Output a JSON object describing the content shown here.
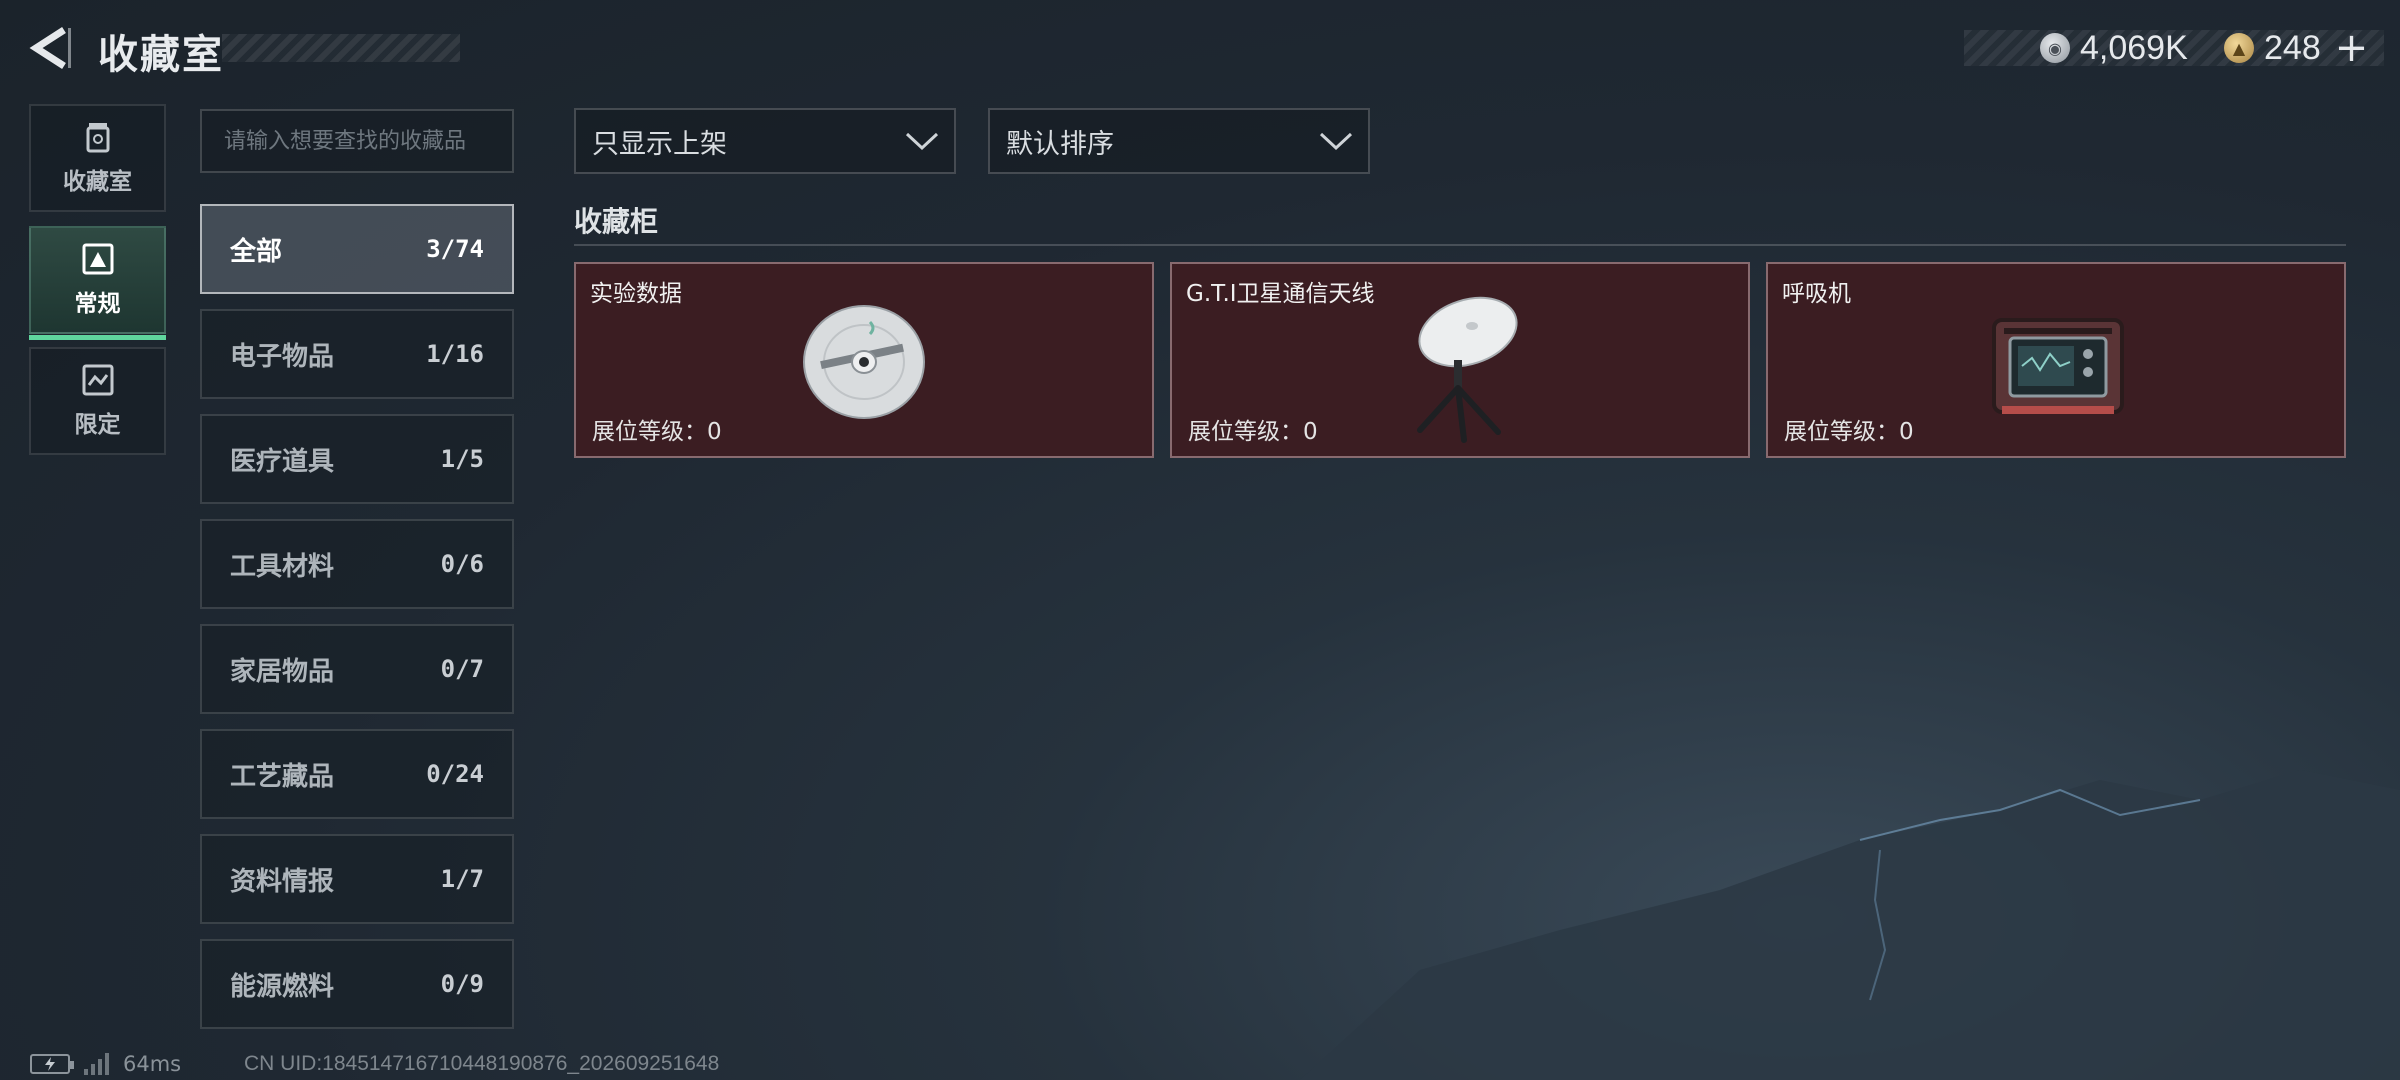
{
  "header": {
    "title": "收藏室",
    "currency": [
      {
        "icon": "silver-coin-icon",
        "value": "4,069K"
      },
      {
        "icon": "gold-coin-icon",
        "value": "248"
      }
    ],
    "add_label": "+"
  },
  "rail": {
    "items": [
      {
        "label": "收藏室",
        "icon": "collection-room-icon",
        "active": false
      },
      {
        "label": "常规",
        "icon": "regular-icon",
        "active": true
      },
      {
        "label": "限定",
        "icon": "limited-icon",
        "active": false
      }
    ]
  },
  "search": {
    "placeholder": "请输入想要查找的收藏品"
  },
  "categories": [
    {
      "name": "全部",
      "count": "3/74",
      "active": true
    },
    {
      "name": "电子物品",
      "count": "1/16"
    },
    {
      "name": "医疗道具",
      "count": "1/5"
    },
    {
      "name": "工具材料",
      "count": "0/6"
    },
    {
      "name": "家居物品",
      "count": "0/7"
    },
    {
      "name": "工艺藏品",
      "count": "0/24"
    },
    {
      "name": "资料情报",
      "count": "1/7"
    },
    {
      "name": "能源燃料",
      "count": "0/9"
    }
  ],
  "filters": {
    "shelf": "只显示上架",
    "sort": "默认排序"
  },
  "cabinet": {
    "title": "收藏柜",
    "items": [
      {
        "name": "实验数据",
        "level": "展位等级：0",
        "icon": "data-disc-icon"
      },
      {
        "name": "G.T.I卫星通信天线",
        "level": "展位等级：0",
        "icon": "satellite-antenna-icon"
      },
      {
        "name": "呼吸机",
        "level": "展位等级：0",
        "icon": "ventilator-icon"
      }
    ]
  },
  "status": {
    "ping": "64ms",
    "uid": "CN UID:184514716710448190876_202609251648"
  },
  "colors": {
    "accent_green": "#5fd69d",
    "card_bg": "#3b1d22",
    "background": "#222c36"
  }
}
